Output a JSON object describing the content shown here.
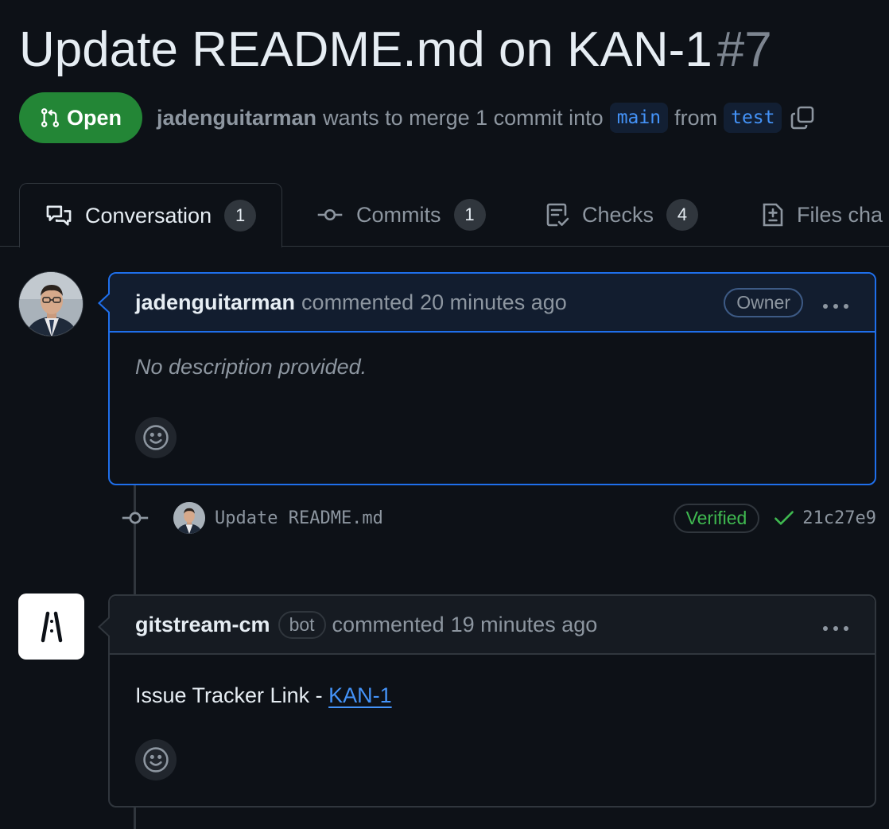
{
  "pr": {
    "title": "Update README.md on KAN-1",
    "number": "#7",
    "state": "Open",
    "author": "jadenguitarman",
    "merge_text": "wants to merge 1 commit into",
    "base_branch": "main",
    "from_text": "from",
    "head_branch": "test"
  },
  "tabs": [
    {
      "label": "Conversation",
      "count": "1",
      "icon": "conversation-icon"
    },
    {
      "label": "Commits",
      "count": "1",
      "icon": "commit-icon"
    },
    {
      "label": "Checks",
      "count": "4",
      "icon": "checklist-icon"
    },
    {
      "label": "Files cha",
      "icon": "file-diff-icon"
    }
  ],
  "comments": [
    {
      "author": "jadenguitarman",
      "action": "commented",
      "time": "20 minutes ago",
      "role": "Owner",
      "body": "No description provided."
    },
    {
      "author": "gitstream-cm",
      "bot_label": "bot",
      "action": "commented",
      "time": "19 minutes ago",
      "body_prefix": "Issue Tracker Link - ",
      "link_text": "KAN-1"
    }
  ],
  "commit": {
    "message": "Update README.md",
    "verified": "Verified",
    "sha": "21c27e9"
  },
  "icons": {
    "state": "git-pull-request-icon",
    "copy": "copy-icon",
    "more": "kebab-horizontal-icon",
    "reaction": "smiley-icon",
    "check": "check-icon",
    "bot_logo": "gitstream-logo-icon"
  },
  "colors": {
    "background": "#0d1117",
    "open_green": "#238636",
    "accent_blue": "#4493f8",
    "verified_green": "#3fb950",
    "muted": "#8d96a0"
  }
}
